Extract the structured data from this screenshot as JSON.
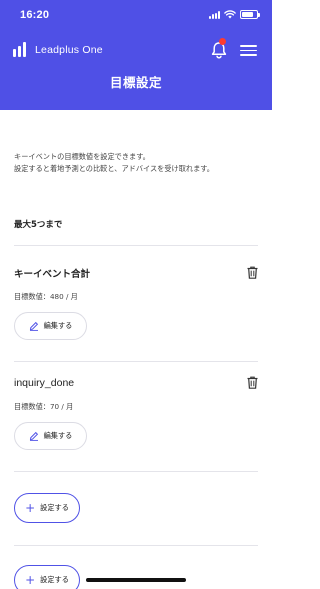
{
  "status_bar": {
    "time": "16:20",
    "battery_level": 0.8
  },
  "app": {
    "name": "Leadplus One"
  },
  "page": {
    "title": "目標設定",
    "description_line1": "キーイベントの目標数値を設定できます。",
    "description_line2": "設定すると着地予測との比較と、アドバイスを受け取れます。",
    "limit_note": "最大5つまで"
  },
  "goals": [
    {
      "name": "キーイベント合計",
      "target": "目標数値：480 / 月",
      "edit_label": "編集する"
    },
    {
      "name": "inquiry_done",
      "target": "目標数値：70 / 月",
      "edit_label": "編集する"
    }
  ],
  "add_slots": [
    {
      "label": "設定する"
    },
    {
      "label": "設定する"
    }
  ],
  "colors": {
    "accent": "#4f50e6",
    "notification_dot": "#ff3b30"
  },
  "icons": {
    "bell": "bell-icon",
    "menu": "hamburger-menu-icon",
    "trash": "trash-icon",
    "pencil": "pencil-icon",
    "plus": "plus-icon"
  }
}
